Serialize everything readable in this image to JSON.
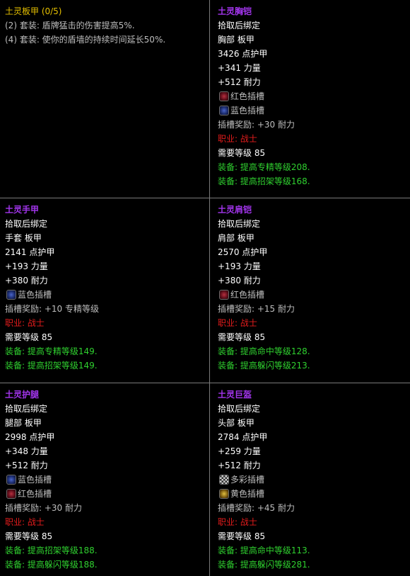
{
  "set": {
    "title": "土灵板甲 (0/5)",
    "bonuses": [
      "(2) 套装: 盾牌猛击的伤害提高5%.",
      "(4) 套装: 使你的盾墙的持续时间延长50%."
    ]
  },
  "items": [
    {
      "name": "土灵胸铠",
      "bind": "拾取后绑定",
      "slot": "胸部 板甲",
      "armor": "3426 点护甲",
      "stat1": "+341 力量",
      "stat2": "+512 耐力",
      "sockets": [
        {
          "icon": "red-socket-icon",
          "label": "红色插槽"
        },
        {
          "icon": "blue-socket-icon",
          "label": "蓝色插槽"
        }
      ],
      "socket_bonus": "插槽奖励: +30 耐力",
      "class": "职业: 战士",
      "level": "需要等级 85",
      "equips": [
        "装备: 提高专精等级208.",
        "装备: 提高招架等级168."
      ]
    },
    {
      "name": "土灵手甲",
      "bind": "拾取后绑定",
      "slot": "手套 板甲",
      "armor": "2141 点护甲",
      "stat1": "+193 力量",
      "stat2": "+380 耐力",
      "sockets": [
        {
          "icon": "blue-socket-icon",
          "label": "蓝色插槽"
        }
      ],
      "socket_bonus": "插槽奖励: +10 专精等级",
      "class": "职业: 战士",
      "level": "需要等级 85",
      "equips": [
        "装备: 提高专精等级149.",
        "装备: 提高招架等级149."
      ]
    },
    {
      "name": "土灵肩铠",
      "bind": "拾取后绑定",
      "slot": "肩部 板甲",
      "armor": "2570 点护甲",
      "stat1": "+193 力量",
      "stat2": "+380 耐力",
      "sockets": [
        {
          "icon": "red-socket-icon",
          "label": "红色插槽"
        }
      ],
      "socket_bonus": "插槽奖励: +15 耐力",
      "class": "职业: 战士",
      "level": "需要等级 85",
      "equips": [
        "装备: 提高命中等级128.",
        "装备: 提高躲闪等级213."
      ]
    },
    {
      "name": "土灵护腿",
      "bind": "拾取后绑定",
      "slot": "腿部 板甲",
      "armor": "2998 点护甲",
      "stat1": "+348 力量",
      "stat2": "+512 耐力",
      "sockets": [
        {
          "icon": "blue-socket-icon",
          "label": "蓝色插槽"
        },
        {
          "icon": "red-socket-icon",
          "label": "红色插槽"
        }
      ],
      "socket_bonus": "插槽奖励: +30 耐力",
      "class": "职业: 战士",
      "level": "需要等级 85",
      "equips": [
        "装备: 提高招架等级188.",
        "装备: 提高躲闪等级188."
      ]
    },
    {
      "name": "土灵巨盔",
      "bind": "拾取后绑定",
      "slot": "头部 板甲",
      "armor": "2784 点护甲",
      "stat1": "+259 力量",
      "stat2": "+512 耐力",
      "sockets": [
        {
          "icon": "meta-socket-icon",
          "label": "多彩插槽"
        },
        {
          "icon": "yellow-socket-icon",
          "label": "黄色插槽"
        }
      ],
      "socket_bonus": "插槽奖励: +45 耐力",
      "class": "职业: 战士",
      "level": "需要等级 85",
      "equips": [
        "装备: 提高命中等级113.",
        "装备: 提高躲闪等级281."
      ]
    }
  ]
}
